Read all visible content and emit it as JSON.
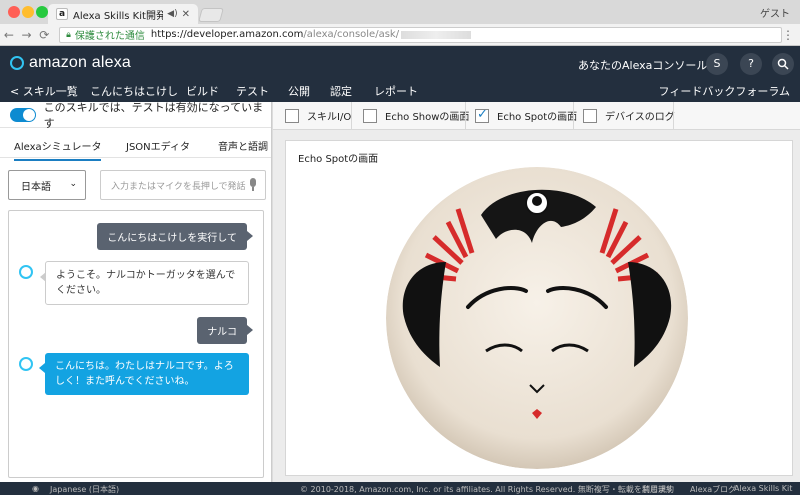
{
  "browser": {
    "tab_title": "Alexa Skills Kit開発者コンソール",
    "tab_favicon": "a",
    "guest_label": "ゲスト",
    "secure_label": "保護された通信",
    "url_host": "https://developer.amazon.com",
    "url_path": "/alexa/console/ask/",
    "back_icon": "←",
    "forward_icon": "→",
    "reload_icon": "C",
    "lock_icon": "lock-icon",
    "menu_icon": "⋮",
    "traffic_colors": [
      "#ff5f56",
      "#ffbd2e",
      "#27c93f"
    ]
  },
  "header": {
    "logo_text": "amazon alexa",
    "console_label": "あなたのAlexaコンソール",
    "avatar_letter": "S",
    "help_icon": "?",
    "search_icon": "⚲",
    "nav": [
      {
        "label": "< スキル一覧",
        "active": false
      },
      {
        "label": "こんにちはこけし",
        "active": false
      },
      {
        "label": "ビルド",
        "active": false
      },
      {
        "label": "テスト",
        "active": true
      },
      {
        "label": "公開",
        "active": false
      },
      {
        "label": "認定",
        "active": false
      },
      {
        "label": "レポート",
        "active": false
      }
    ],
    "feedback_label": "フィードバックフォーラム"
  },
  "left": {
    "toggle_label": "このスキルでは、テストは有効になっています",
    "toggle_on": true,
    "subtabs": [
      {
        "label": "Alexaシミュレータ",
        "active": true
      },
      {
        "label": "JSONエディタ",
        "active": false
      },
      {
        "label": "音声と語調",
        "active": false
      }
    ],
    "language_value": "日本語",
    "utterance_placeholder": "入力またはマイクを長押しで発話",
    "messages": [
      {
        "from": "user",
        "text": "こんにちはこけしを実行して"
      },
      {
        "from": "alexa",
        "style": "plain",
        "text": "ようこそ。ナルコかトーガッタを選んでください。"
      },
      {
        "from": "user",
        "text": "ナルコ"
      },
      {
        "from": "alexa",
        "style": "blue",
        "text": "こんにちは。わたしはナルコです。よろしく！また呼んでくださいね。"
      }
    ]
  },
  "right": {
    "checkboxes": [
      {
        "label": "スキルI/O",
        "checked": false
      },
      {
        "label": "Echo Showの画面",
        "checked": false
      },
      {
        "label": "Echo Spotの画面",
        "checked": true
      },
      {
        "label": "デバイスのログ",
        "checked": false
      }
    ],
    "display_title": "Echo Spotの画面"
  },
  "footer": {
    "language": "Japanese (日本語)",
    "copyright": "© 2010-2018, Amazon.com, Inc. or its affiliates. All Rights Reserved. 無断複写・転載を禁じます",
    "links": [
      "利用規約",
      "Alexaブログ",
      "Alexa Skills Kit"
    ]
  }
}
